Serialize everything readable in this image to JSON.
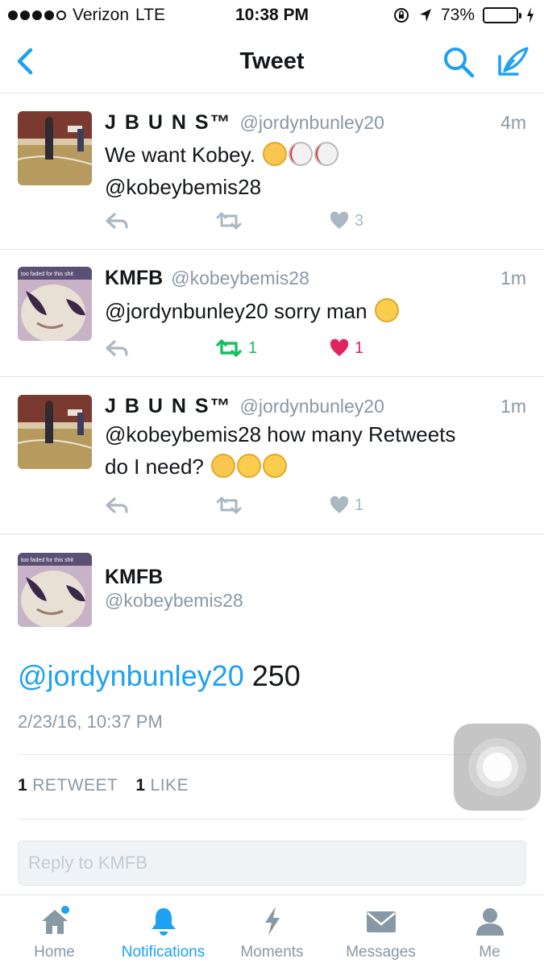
{
  "status_bar": {
    "carrier": "Verizon",
    "network": "LTE",
    "time": "10:38 PM",
    "battery": "73%",
    "battery_level": 0.73
  },
  "nav": {
    "title": "Tweet",
    "icons": [
      "back-chevron-icon",
      "search-icon",
      "compose-icon"
    ]
  },
  "tweets": [
    {
      "name": "J B U N S™",
      "handle": "@jordynbunley20",
      "time": "4m",
      "text_line1": "We want Kobey.",
      "text_line2": "@kobeybemis28",
      "emojis": [
        "tears-of-joy",
        "baseball",
        "baseball"
      ],
      "retweet_count": "",
      "like_count": "3",
      "retweeted": false,
      "liked": false
    },
    {
      "name": "KMFB",
      "handle": "@kobeybemis28",
      "time": "1m",
      "text_line1": "@jordynbunley20 sorry man",
      "emojis": [
        "confused-face"
      ],
      "avatar_caption": "too faded for this shit",
      "retweet_count": "1",
      "like_count": "1",
      "retweeted": true,
      "liked": true
    },
    {
      "name": "J B U N S™",
      "handle": "@jordynbunley20",
      "time": "1m",
      "text_line1": "@kobeybemis28 how many Retweets",
      "text_line2": "do I need?",
      "emojis": [
        "tears-of-joy",
        "weary-face",
        "upside-down-face"
      ],
      "retweet_count": "",
      "like_count": "1",
      "retweeted": false,
      "liked": false
    }
  ],
  "main_tweet": {
    "name": "KMFB",
    "handle": "@kobeybemis28",
    "avatar_caption": "too faded for this shit",
    "mention": "@jordynbunley20",
    "text": " 250",
    "date": "2/23/16, 10:37 PM",
    "retweets_count": "1",
    "retweets_label": "RETWEET",
    "likes_count": "1",
    "likes_label": "LIKE"
  },
  "reply": {
    "placeholder": "Reply to KMFB"
  },
  "tabs": [
    {
      "label": "Home",
      "icon": "home-icon",
      "active": false,
      "badge": true
    },
    {
      "label": "Notifications",
      "icon": "bell-icon",
      "active": true
    },
    {
      "label": "Moments",
      "icon": "lightning-icon",
      "active": false
    },
    {
      "label": "Messages",
      "icon": "envelope-icon",
      "active": false
    },
    {
      "label": "Me",
      "icon": "person-icon",
      "active": false
    }
  ],
  "colors": {
    "accent": "#1da1f2",
    "retweet_green": "#17bf63",
    "like_red": "#e0245e",
    "muted": "#8899a6",
    "action_gray": "#aab8c2"
  }
}
